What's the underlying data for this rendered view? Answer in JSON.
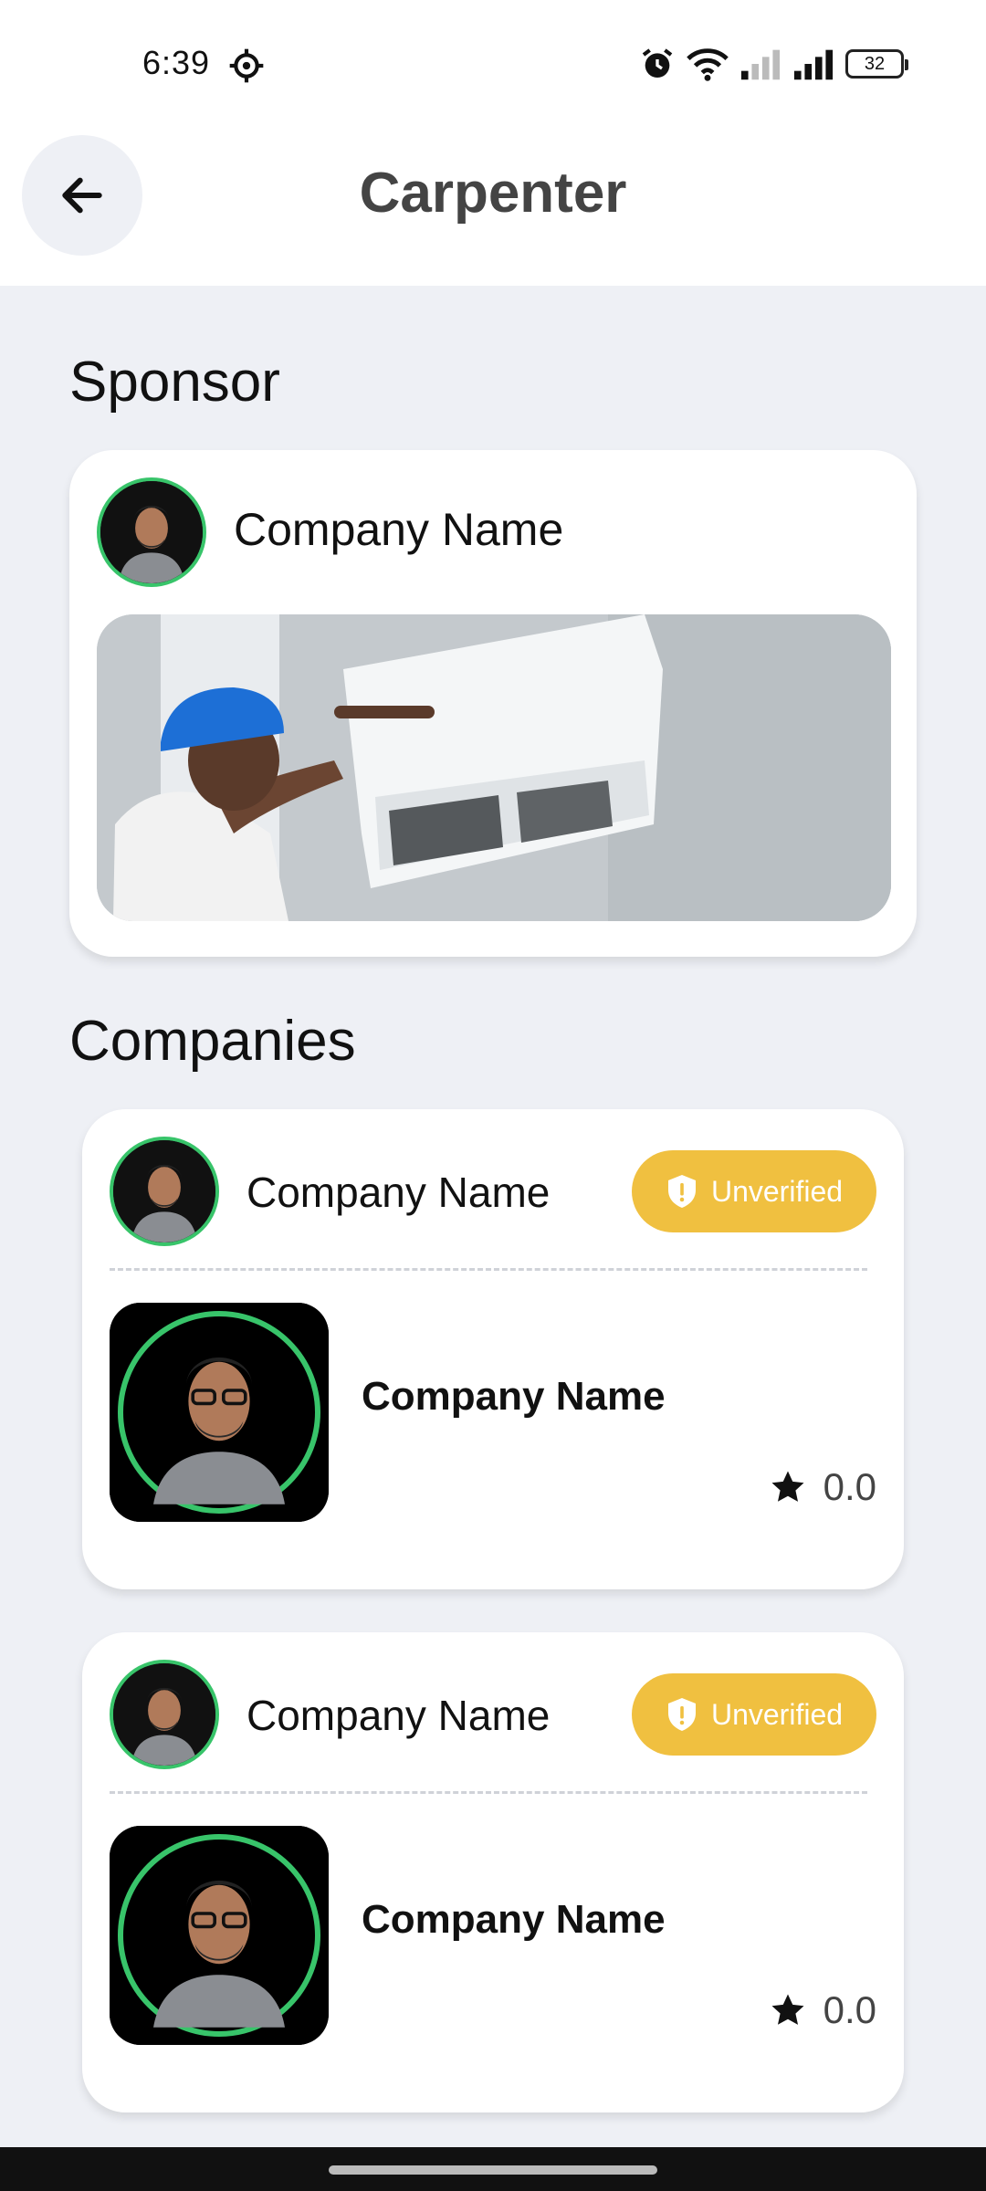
{
  "status_bar": {
    "time": "6:39",
    "battery": "32"
  },
  "header": {
    "title": "Carpenter"
  },
  "sponsor": {
    "heading": "Sponsor",
    "company_name": "Company Name"
  },
  "companies": {
    "heading": "Companies",
    "items": [
      {
        "name": "Company Name",
        "badge": "Unverified",
        "title": "Company Name",
        "rating": "0.0"
      },
      {
        "name": "Company Name",
        "badge": "Unverified",
        "title": "Company Name",
        "rating": "0.0"
      }
    ]
  },
  "colors": {
    "accent_badge": "#f0c040",
    "avatar_ring": "#38c46a",
    "background": "#eef0f5"
  }
}
